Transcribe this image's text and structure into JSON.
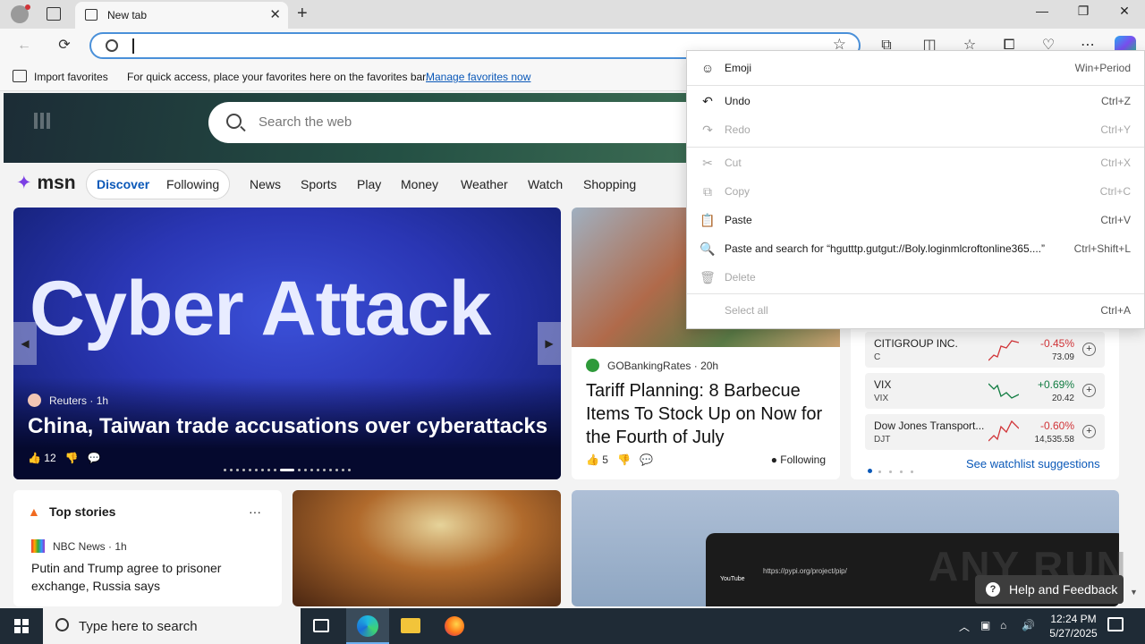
{
  "browser": {
    "tab_title": "New tab",
    "address_value": "",
    "new_tab_symbol": "+"
  },
  "favorites_bar": {
    "import_label": "Import favorites",
    "message": "For quick access, place your favorites here on the favorites bar.",
    "manage_link": "Manage favorites now"
  },
  "search": {
    "placeholder": "Search the web"
  },
  "msn": {
    "logo": "msn",
    "tabs": [
      "Discover",
      "Following"
    ],
    "nav": [
      "News",
      "Sports",
      "Play",
      "Money",
      "Weather",
      "Watch",
      "Shopping"
    ]
  },
  "hero_card": {
    "image_text": "Cyber Attack",
    "source": "Reuters",
    "time": "1h",
    "headline": "China, Taiwan trade accusations over cyberattacks",
    "likes": "12"
  },
  "tariff_card": {
    "source": "GOBankingRates",
    "time": "20h",
    "headline": "Tariff Planning: 8 Barbecue Items To Stock Up on Now for the Fourth of July",
    "likes": "5",
    "following_label": "Following"
  },
  "watchlist": {
    "rows": [
      {
        "name": "CITIGROUP INC.",
        "ticker": "C",
        "change": "-0.45%",
        "price": "73.09"
      },
      {
        "name": "VIX",
        "ticker": "VIX",
        "change": "+0.69%",
        "price": "20.42"
      },
      {
        "name": "Dow Jones Transport...",
        "ticker": "DJT",
        "change": "-0.60%",
        "price": "14,535.58"
      }
    ],
    "suggestions_link": "See watchlist suggestions"
  },
  "top_stories": {
    "title": "Top stories",
    "more": "···",
    "source": "NBC News",
    "time": "1h",
    "headline": "Putin and Trump agree to prisoner exchange, Russia says"
  },
  "laptop_card": {
    "url_text": "https://pypi.org/project/pip/",
    "tab_text": "YouTube"
  },
  "watermark": "ANY RUN",
  "help": {
    "label": "Help and Feedback"
  },
  "context_menu": {
    "items": [
      {
        "label": "Emoji",
        "shortcut": "Win+Period",
        "icon": "emoji-icon"
      },
      {
        "label": "Undo",
        "shortcut": "Ctrl+Z",
        "icon": "undo-icon"
      },
      {
        "label": "Redo",
        "shortcut": "Ctrl+Y",
        "icon": "redo-icon"
      },
      {
        "label": "Cut",
        "shortcut": "Ctrl+X",
        "icon": "cut-icon"
      },
      {
        "label": "Copy",
        "shortcut": "Ctrl+C",
        "icon": "copy-icon"
      },
      {
        "label": "Paste",
        "shortcut": "Ctrl+V",
        "icon": "paste-icon"
      },
      {
        "label": "Paste and search for “hgutttp.gutgut://Boly.loginmlcroftonline365....”",
        "shortcut": "Ctrl+Shift+L",
        "icon": "paste-search-icon"
      },
      {
        "label": "Delete",
        "shortcut": "",
        "icon": "delete-icon"
      },
      {
        "label": "Select all",
        "shortcut": "Ctrl+A",
        "icon": ""
      }
    ]
  },
  "taskbar": {
    "search_placeholder": "Type here to search",
    "time": "12:24 PM",
    "date": "5/27/2025"
  },
  "colors": {
    "accent": "#0a58b8",
    "negative": "#d13438",
    "positive": "#107c41",
    "taskbar": "#1f2b36"
  }
}
